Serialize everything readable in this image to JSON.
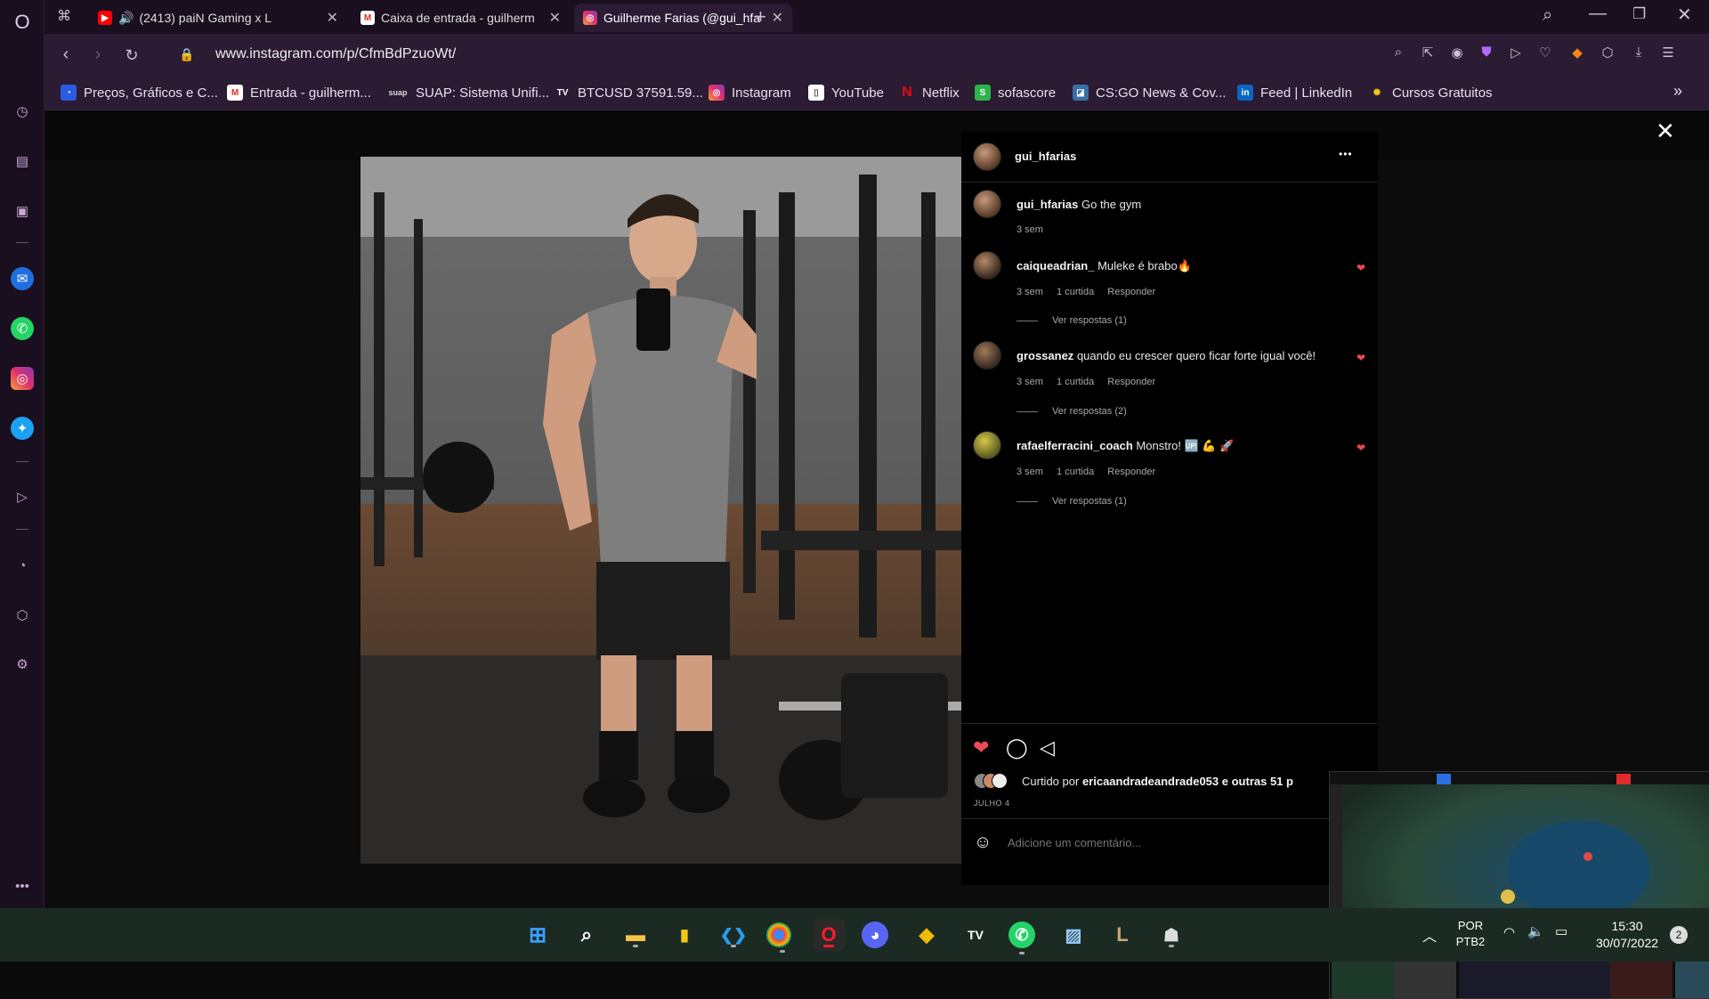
{
  "browser": {
    "tabs": [
      {
        "label": "(2413) paiN Gaming x L",
        "favicon": "youtube-icon"
      },
      {
        "label": "Caixa de entrada - guilherm",
        "favicon": "gmail-icon"
      },
      {
        "label": "Guilherme Farias (@gui_hfa",
        "favicon": "instagram-icon"
      }
    ],
    "url": "www.instagram.com/p/CfmBdPzuoWt/",
    "bookmarks": [
      {
        "label": "Preços, Gráficos e C..."
      },
      {
        "label": "Entrada - guilherm..."
      },
      {
        "label": "SUAP: Sistema Unifi..."
      },
      {
        "label": "BTCUSD 37591.59..."
      },
      {
        "label": "Instagram"
      },
      {
        "label": "YouTube"
      },
      {
        "label": "Netflix"
      },
      {
        "label": "sofascore"
      },
      {
        "label": "CS:GO News & Cov..."
      },
      {
        "label": "Feed | LinkedIn"
      },
      {
        "label": "Cursos Gratuitos"
      }
    ],
    "bookmarks_more": "»"
  },
  "post": {
    "author": "gui_hfarias",
    "more": "•••",
    "caption": {
      "user": "gui_hfarias",
      "text": "Go the gym",
      "time": "3 sem"
    },
    "comments": [
      {
        "user": "caiqueadrian_",
        "text": "Muleke é brabo🔥",
        "time": "3 sem",
        "likes": "1 curtida",
        "reply": "Responder",
        "view_replies": "Ver respostas (1)"
      },
      {
        "user": "grossanez",
        "text": "quando eu crescer quero ficar forte igual você!",
        "time": "3 sem",
        "likes": "1 curtida",
        "reply": "Responder",
        "view_replies": "Ver respostas (2)"
      },
      {
        "user": "rafaelferracini_coach",
        "text": "Monstro! 🆙 💪 🚀",
        "time": "3 sem",
        "likes": "1 curtida",
        "reply": "Responder",
        "view_replies": "Ver respostas (1)"
      }
    ],
    "liked_by_prefix": "Curtido por",
    "liked_by_user": "ericaandradeandrade053",
    "liked_by_suffix": "e outras 51 p",
    "date": "JULHO 4",
    "comment_placeholder": "Adicione um comentário..."
  },
  "taskbar": {
    "lang_line1": "POR",
    "lang_line2": "PTB2",
    "time": "15:30",
    "date": "30/07/2022",
    "notifications": "2"
  },
  "colors": {
    "opera_bg": "#1a0f1f",
    "toolbar_bg": "#2b1b33",
    "like_red": "#ed4956"
  }
}
